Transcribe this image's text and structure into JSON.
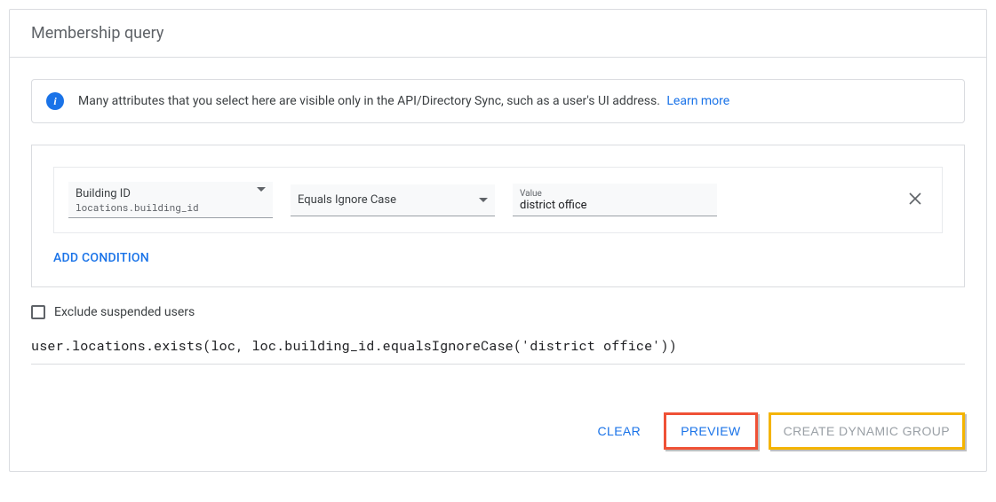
{
  "header": {
    "title": "Membership query"
  },
  "info": {
    "text": "Many attributes that you select here are visible only in the API/Directory Sync, such as a user's UI address.",
    "link_text": "Learn more"
  },
  "condition": {
    "attribute_label": "Building ID",
    "attribute_path": "locations.building_id",
    "operator": "Equals Ignore Case",
    "value_label": "Value",
    "value": "district office"
  },
  "add_condition_label": "ADD CONDITION",
  "exclude_label": "Exclude suspended users",
  "query_text": "user.locations.exists(loc, loc.building_id.equalsIgnoreCase('district office'))",
  "actions": {
    "clear": "CLEAR",
    "preview": "PREVIEW",
    "create": "CREATE DYNAMIC GROUP"
  }
}
